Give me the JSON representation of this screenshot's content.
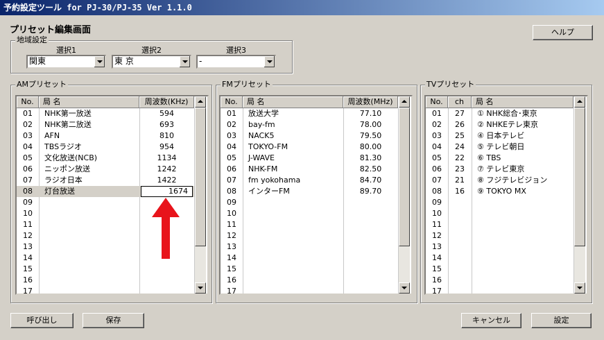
{
  "window": {
    "title": "予約設定ツール for PJ-30/PJ-35 Ver 1.1.0"
  },
  "page_title": "プリセット編集画面",
  "help_label": "ヘルプ",
  "region": {
    "legend": "地域設定",
    "selects": [
      {
        "label": "選択1",
        "value": "関東"
      },
      {
        "label": "選択2",
        "value": "東 京"
      },
      {
        "label": "選択3",
        "value": "-"
      }
    ]
  },
  "am": {
    "legend": "AMプリセット",
    "columns": [
      "No.",
      "局 名",
      "周波数(KHz)"
    ],
    "rows": [
      [
        "01",
        "NHK第一放送",
        "594"
      ],
      [
        "02",
        "NHK第二放送",
        "693"
      ],
      [
        "03",
        "AFN",
        "810"
      ],
      [
        "04",
        "TBSラジオ",
        "954"
      ],
      [
        "05",
        "文化放送(NCB)",
        "1134"
      ],
      [
        "06",
        "ニッポン放送",
        "1242"
      ],
      [
        "07",
        "ラジオ日本",
        "1422"
      ],
      [
        "08",
        "灯台放送",
        "1674"
      ],
      [
        "09",
        "",
        ""
      ],
      [
        "10",
        "",
        ""
      ],
      [
        "11",
        "",
        ""
      ],
      [
        "12",
        "",
        ""
      ],
      [
        "13",
        "",
        ""
      ],
      [
        "14",
        "",
        ""
      ],
      [
        "15",
        "",
        ""
      ],
      [
        "16",
        "",
        ""
      ],
      [
        "17",
        "",
        ""
      ]
    ],
    "editing_row": 7
  },
  "fm": {
    "legend": "FMプリセット",
    "columns": [
      "No.",
      "局 名",
      "周波数(MHz)"
    ],
    "rows": [
      [
        "01",
        "放送大学",
        "77.10"
      ],
      [
        "02",
        "bay-fm",
        "78.00"
      ],
      [
        "03",
        "NACK5",
        "79.50"
      ],
      [
        "04",
        "TOKYO-FM",
        "80.00"
      ],
      [
        "05",
        "J-WAVE",
        "81.30"
      ],
      [
        "06",
        "NHK-FM",
        "82.50"
      ],
      [
        "07",
        "fm yokohama",
        "84.70"
      ],
      [
        "08",
        "インターFM",
        "89.70"
      ],
      [
        "09",
        "",
        ""
      ],
      [
        "10",
        "",
        ""
      ],
      [
        "11",
        "",
        ""
      ],
      [
        "12",
        "",
        ""
      ],
      [
        "13",
        "",
        ""
      ],
      [
        "14",
        "",
        ""
      ],
      [
        "15",
        "",
        ""
      ],
      [
        "16",
        "",
        ""
      ],
      [
        "17",
        "",
        ""
      ]
    ]
  },
  "tv": {
    "legend": "TVプリセット",
    "columns": [
      "No.",
      "ch",
      "局 名"
    ],
    "rows": [
      [
        "01",
        "27",
        "① NHK総合･東京"
      ],
      [
        "02",
        "26",
        "② NHKEテレ東京"
      ],
      [
        "03",
        "25",
        "④ 日本テレビ"
      ],
      [
        "04",
        "24",
        "⑤ テレビ朝日"
      ],
      [
        "05",
        "22",
        "⑥ TBS"
      ],
      [
        "06",
        "23",
        "⑦ テレビ東京"
      ],
      [
        "07",
        "21",
        "⑧ フジテレビジョン"
      ],
      [
        "08",
        "16",
        "⑨ TOKYO MX"
      ],
      [
        "09",
        "",
        ""
      ],
      [
        "10",
        "",
        ""
      ],
      [
        "11",
        "",
        ""
      ],
      [
        "12",
        "",
        ""
      ],
      [
        "13",
        "",
        ""
      ],
      [
        "14",
        "",
        ""
      ],
      [
        "15",
        "",
        ""
      ],
      [
        "16",
        "",
        ""
      ],
      [
        "17",
        "",
        ""
      ]
    ]
  },
  "buttons": {
    "load": "呼び出し",
    "save": "保存",
    "cancel": "キャンセル",
    "apply": "設定"
  },
  "annotation": {
    "arrow_color": "#e8141b"
  }
}
